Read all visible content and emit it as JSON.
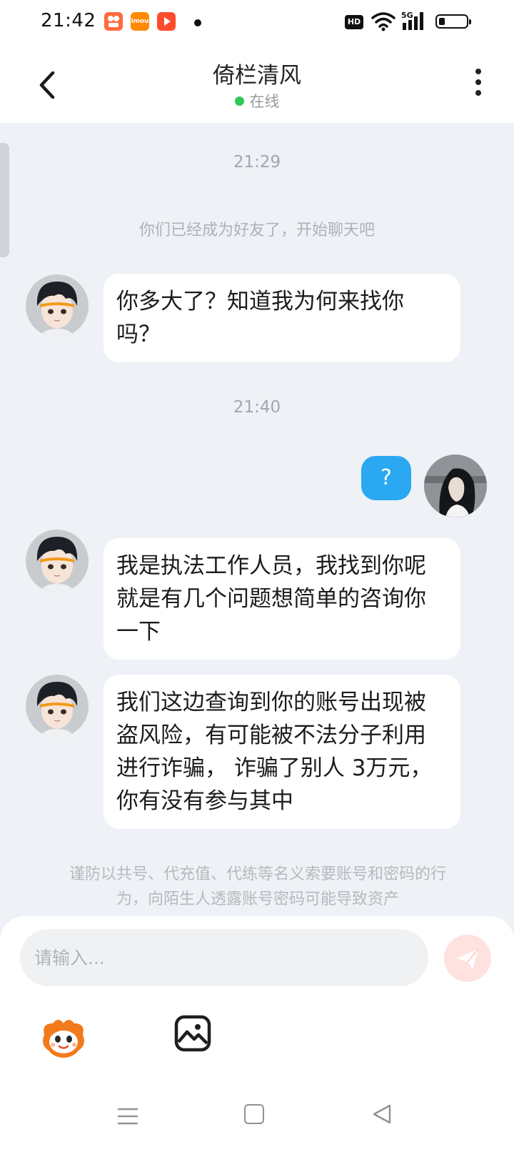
{
  "status_bar": {
    "time": "21:42",
    "apps": [
      {
        "icon": "app-icon-red",
        "label": "",
        "color": "#ff6a3d"
      },
      {
        "icon": "imou-icon",
        "label": "imou",
        "color": "#ff8a00"
      },
      {
        "icon": "video-play-icon",
        "label": "",
        "color": "#ff4b2b"
      }
    ],
    "hd_label": "HD",
    "network_label": "5G",
    "battery_level_percent": 20
  },
  "header": {
    "title": "倚栏清风",
    "status": "在线",
    "online_color": "#2fc85a"
  },
  "messages": [
    {
      "type": "time",
      "text": "21:29"
    },
    {
      "type": "system",
      "text": "你们已经成为好友了，开始聊天吧"
    },
    {
      "type": "incoming",
      "text": "你多大了？知道我为何来找你吗？"
    },
    {
      "type": "time",
      "text": "21:40"
    },
    {
      "type": "outgoing",
      "text": "?"
    },
    {
      "type": "incoming",
      "text": "我是执法工作人员，我找到你呢就是有几个问题想简单的咨询你一下"
    },
    {
      "type": "incoming",
      "text": "我们这边查询到你的账号出现被盗风险，有可能被不法分子利用进行诈骗， 诈骗了别人 3万元，你有没有参与其中"
    }
  ],
  "warning": "谨防以共号、代充值、代练等名义索要账号和密码的行为，向陌生人透露账号密码可能导致资产",
  "input": {
    "placeholder": "请输入...",
    "value": ""
  },
  "colors": {
    "outgoing_bubble": "#2aa8f2",
    "incoming_bubble": "#ffffff",
    "background": "#eef1f5",
    "send_button": "#fde2df"
  }
}
